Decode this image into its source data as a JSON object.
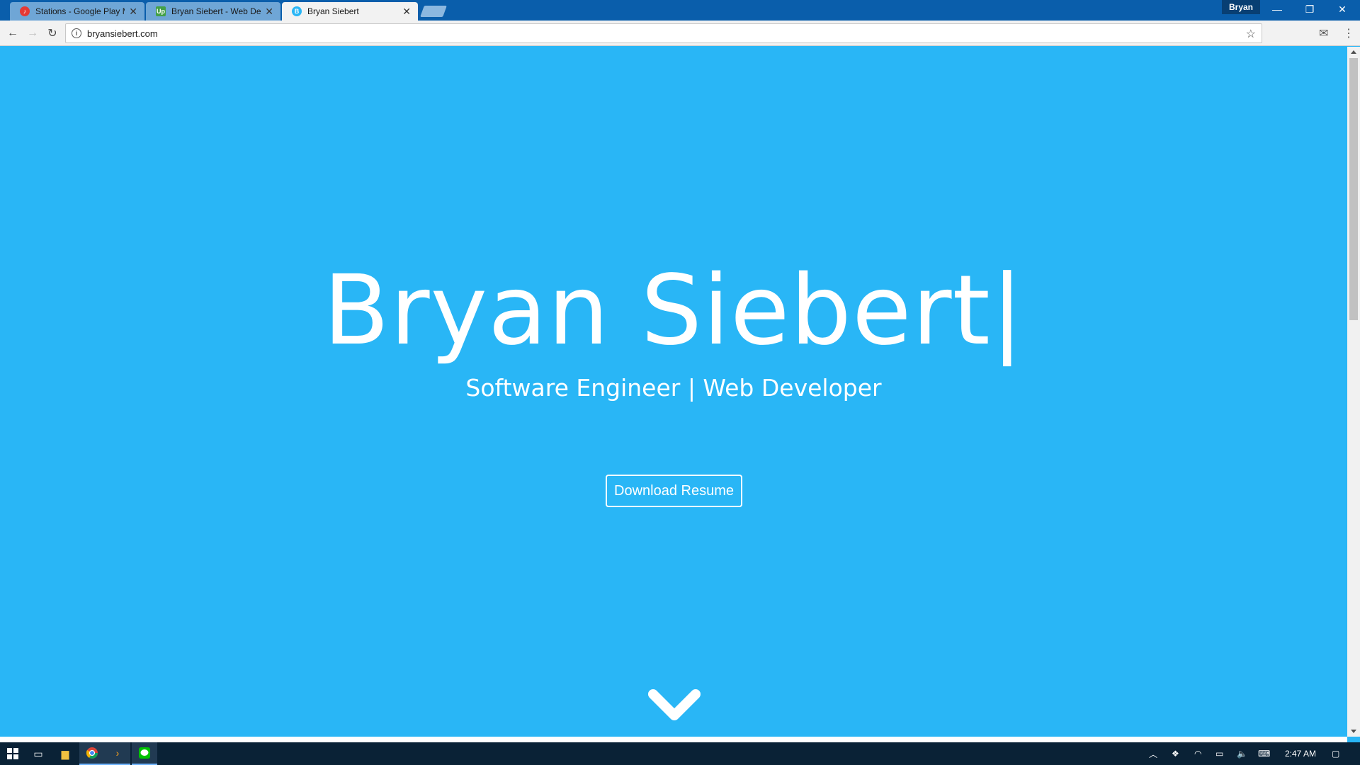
{
  "browser": {
    "tabs": [
      {
        "title": "Stations - Google Play Mu",
        "favicon_color": "#e53935",
        "favicon_text": "♪"
      },
      {
        "title": "Bryan Siebert - Web Dev",
        "favicon_color": "#43a047",
        "favicon_text": "Up"
      },
      {
        "title": "Bryan Siebert",
        "favicon_color": "#29b6f6",
        "favicon_text": "B",
        "active": true
      }
    ],
    "profile_name": "Bryan",
    "url": "bryansiebert.com"
  },
  "page": {
    "name": "Bryan Siebert|",
    "subtitle": "Software Engineer | Web Developer",
    "resume_button": "Download Resume",
    "background_color": "#29b6f6"
  },
  "taskbar": {
    "clock": "2:47 AM"
  }
}
